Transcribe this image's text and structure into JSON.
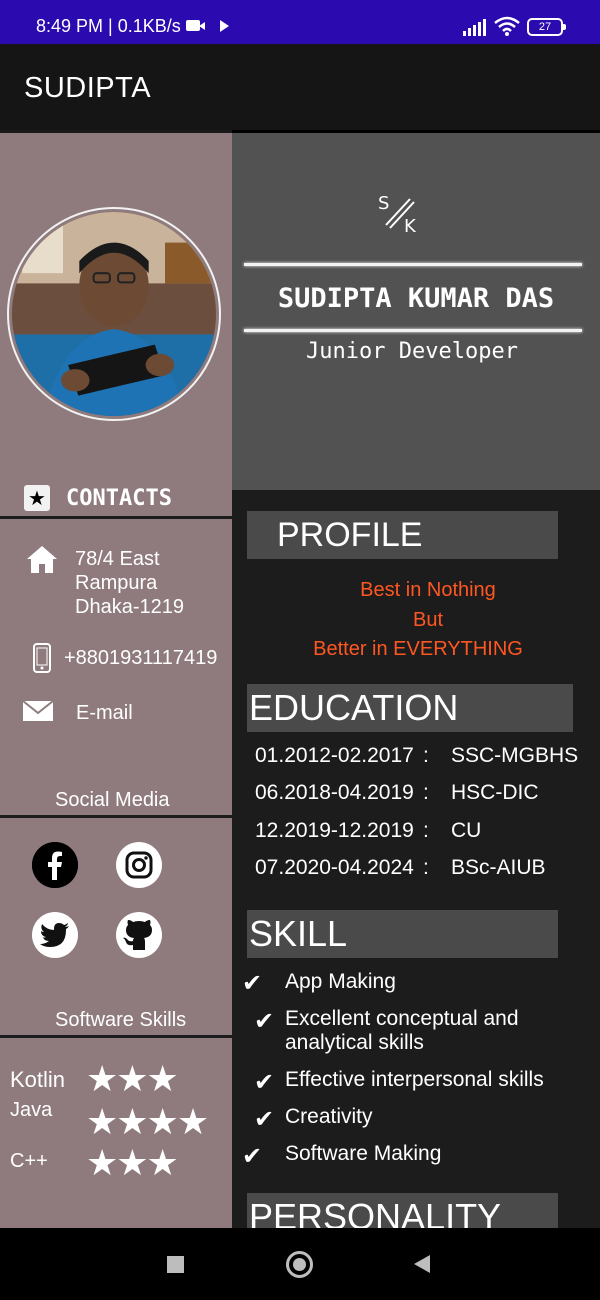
{
  "status_bar": {
    "time": "8:49 PM | 0.1KB/s",
    "battery": "27"
  },
  "app_bar": {
    "title": "SUDIPTA"
  },
  "sidebar": {
    "contacts_label": "CONTACTS",
    "address": [
      "78/4 East",
      "Rampura",
      "Dhaka-1219"
    ],
    "phone": "+8801931117419",
    "email_label": "E-mail",
    "social_media_label": "Social Media",
    "social_icons": [
      "facebook-icon",
      "instagram-icon",
      "twitter-icon",
      "github-icon"
    ],
    "software_skills_label": "Software Skills",
    "software_skills": [
      {
        "name": "Kotlin",
        "rating": 3
      },
      {
        "name": "Java",
        "rating": 4
      },
      {
        "name": "C++",
        "rating": 3
      }
    ]
  },
  "header": {
    "logo_text": "S/K",
    "full_name": "SUDIPTA KUMAR DAS",
    "role": "Junior Developer"
  },
  "profile": {
    "title": "PROFILE",
    "motto": [
      "Best in Nothing",
      "But",
      "Better in EVERYTHING"
    ]
  },
  "education": {
    "title": "EDUCATION",
    "rows": [
      {
        "period": "01.2012-02.2017",
        "sep": ":",
        "school": "SSC-MGBHS"
      },
      {
        "period": "06.2018-04.2019",
        "sep": ":",
        "school": "HSC-DIC"
      },
      {
        "period": "12.2019-12.2019",
        "sep": ":",
        "school": "CU"
      },
      {
        "period": "07.2020-04.2024",
        "sep": ":",
        "school": "BSc-AIUB"
      }
    ]
  },
  "skill": {
    "title": "SKILL",
    "items": [
      "App Making",
      "Excellent conceptual and analytical skills",
      "Effective interpersonal skills",
      "Creativity",
      "Software Making"
    ]
  },
  "personality": {
    "title": "PERSONALITY"
  },
  "colors": {
    "status_bar": "#2b0bb0",
    "sidebar": "#8f7b7e",
    "panel": "#1c1c1c",
    "motto": "#ff5722"
  }
}
